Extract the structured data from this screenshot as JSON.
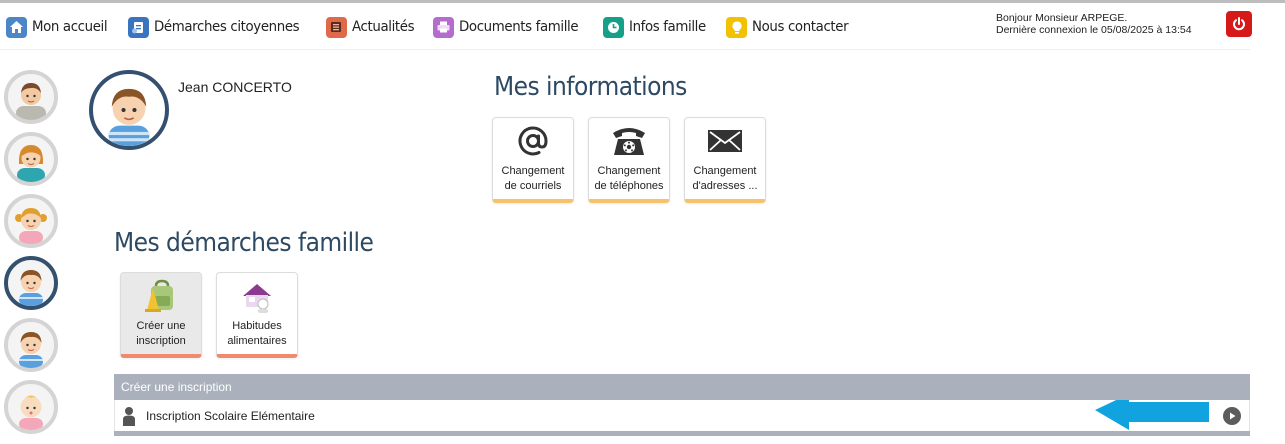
{
  "nav": {
    "items": [
      {
        "label": "Mon accueil",
        "icon": "home-icon",
        "color": "#4a86c8"
      },
      {
        "label": "Démarches citoyennes",
        "icon": "forms-icon",
        "color": "#3a73c0"
      },
      {
        "label": "Actualités",
        "icon": "newspaper-icon",
        "color": "#e0694a"
      },
      {
        "label": "Documents famille",
        "icon": "printer-icon",
        "color": "#b46ccf"
      },
      {
        "label": "Infos famille",
        "icon": "clock-icon",
        "color": "#16a089"
      },
      {
        "label": "Nous contacter",
        "icon": "lightbulb-icon",
        "color": "#f2c200"
      }
    ]
  },
  "header": {
    "greeting": "Bonjour Monsieur ARPEGE.",
    "last_login": "Dernière connexion le 05/08/2025 à 13:54",
    "logout_icon": "power-icon",
    "logout_color": "#d61a1a"
  },
  "family": {
    "members": [
      {
        "icon": "man-avatar-icon"
      },
      {
        "icon": "woman-avatar-icon"
      },
      {
        "icon": "girl-avatar-icon"
      },
      {
        "icon": "boy-avatar-icon",
        "active": true
      },
      {
        "icon": "boy-avatar-icon"
      },
      {
        "icon": "baby-avatar-icon"
      }
    ]
  },
  "profile": {
    "name": "Jean CONCERTO",
    "avatar": "boy-avatar-icon"
  },
  "mes_informations": {
    "title": "Mes informations",
    "tiles": [
      {
        "line1": "Changement",
        "line2": "de courriels",
        "icon": "at-sign-icon"
      },
      {
        "line1": "Changement",
        "line2": "de téléphones",
        "icon": "telephone-icon"
      },
      {
        "line1": "Changement",
        "line2": "d'adresses ...",
        "icon": "envelope-icon"
      }
    ]
  },
  "mes_demarches": {
    "title": "Mes démarches famille",
    "tiles": [
      {
        "line1": "Créer une",
        "line2": "inscription",
        "icon": "school-bag-icon"
      },
      {
        "line1": "Habitudes",
        "line2": "alimentaires",
        "icon": "cafeteria-icon"
      }
    ]
  },
  "inscription_panel": {
    "header": "Créer une inscription",
    "rows": [
      {
        "label": "Inscription Scolaire Elémentaire",
        "icon": "person-icon",
        "action_icon": "play-icon"
      }
    ],
    "pointer_icon": "arrow-left-icon",
    "pointer_color": "#10a3e0"
  }
}
